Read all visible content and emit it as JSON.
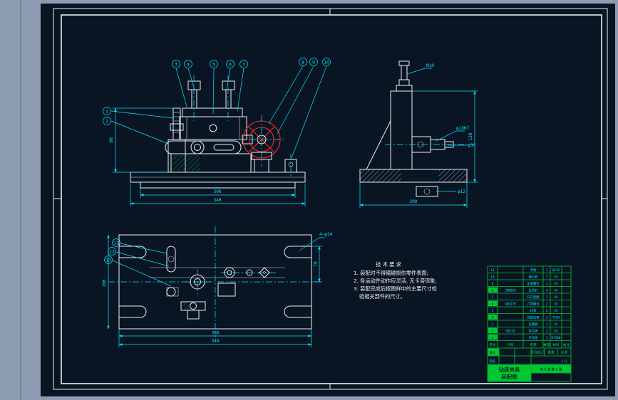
{
  "canvas": {
    "background": "#0a1523",
    "frame_color": "#e9eef4"
  },
  "palette": {
    "dimension": "#00e5ff",
    "outline": "#e9eef4",
    "table_green": "#00c832",
    "handle_red": "#ff2a2a",
    "hatch_olive": "#b9b24a"
  },
  "balloons": [
    "1",
    "2",
    "3",
    "4",
    "5",
    "6",
    "7",
    "8",
    "9",
    "10",
    "11",
    "12",
    "13"
  ],
  "dims": {
    "front": {
      "w1": "300",
      "w2": "340",
      "h": "90"
    },
    "side": {
      "h": "150",
      "w": "200",
      "bolt": "M10",
      "bush": "φ18H7",
      "d2": "φ30",
      "d3": "φ12"
    },
    "plan": {
      "w1": "300",
      "w2": "340",
      "h": "160",
      "r": "70",
      "slots": "4-φ14"
    }
  },
  "notes": {
    "title": "技 术 要 求",
    "line1": "1. 装配时不得磕碰损伤零件表面;",
    "line2": "2. 各运动件动作应灵活, 无卡滞现象;",
    "line3": "3. 装配完成后按图样中的主要尺寸检",
    "line4": "验相关部件的尺寸。"
  },
  "bom": {
    "headers": [
      "序号",
      "代号",
      "名称",
      "数量",
      "材料",
      "备注"
    ],
    "rows": [
      {
        "no": "11",
        "code": "",
        "name": "手柄",
        "qty": "1",
        "mat": "Q235",
        "rem": ""
      },
      {
        "no": "10",
        "code": "",
        "name": "偏心轮",
        "qty": "1",
        "mat": "45",
        "rem": ""
      },
      {
        "no": "9",
        "code": "",
        "name": "压紧螺钉",
        "qty": "1",
        "mat": "45",
        "rem": ""
      },
      {
        "no": "8",
        "code": "JB8029",
        "name": "支承钉",
        "qty": "4",
        "mat": "45",
        "rem": ""
      },
      {
        "no": "7",
        "code": "",
        "name": "开口垫圈",
        "qty": "1",
        "mat": "45",
        "rem": ""
      },
      {
        "no": "6",
        "code": "GB6170",
        "name": "六角螺母",
        "qty": "2",
        "mat": "45",
        "rem": ""
      },
      {
        "no": "5",
        "code": "",
        "name": "衬套",
        "qty": "2",
        "mat": "45",
        "rem": ""
      },
      {
        "no": "4",
        "code": "",
        "name": "固定钻套",
        "qty": "2",
        "mat": "T10A",
        "rem": ""
      },
      {
        "no": "3",
        "code": "",
        "name": "钻模板",
        "qty": "1",
        "mat": "45",
        "rem": ""
      },
      {
        "no": "2",
        "code": "GB119",
        "name": "定位销",
        "qty": "2",
        "mat": "45",
        "rem": ""
      },
      {
        "no": "1",
        "code": "",
        "name": "夹具体",
        "qty": "1",
        "mat": "HT200",
        "rem": ""
      }
    ]
  },
  "title_block": {
    "design": "设计",
    "audit": "审核",
    "stage": "阶段标记",
    "weight": "重量",
    "scale_label": "比例",
    "scale": "1:1",
    "sheet": "共 1 张 第 1 张",
    "name1": "钻床夹具",
    "name2": "装配图"
  }
}
